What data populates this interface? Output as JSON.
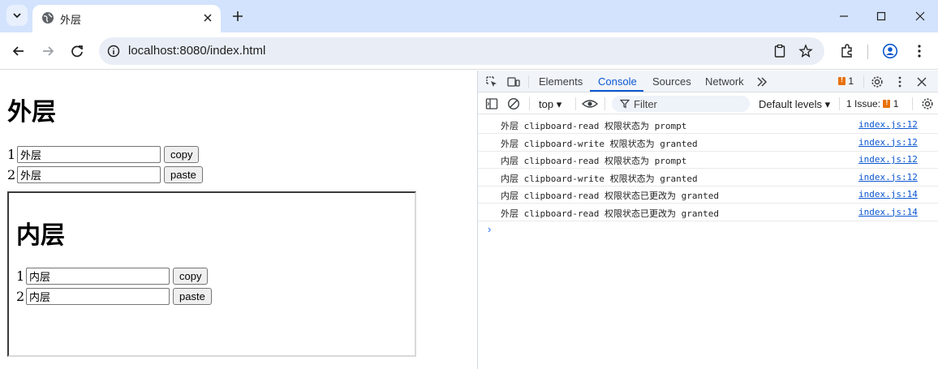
{
  "browser": {
    "tab_title": "外层",
    "url": "localhost:8080/index.html"
  },
  "page": {
    "outer": {
      "heading": "外层",
      "rows": [
        {
          "num": "1",
          "value": "外层",
          "button": "copy"
        },
        {
          "num": "2",
          "value": "外层",
          "button": "paste"
        }
      ]
    },
    "inner": {
      "heading": "内层",
      "rows": [
        {
          "num": "1",
          "value": "内层",
          "button": "copy"
        },
        {
          "num": "2",
          "value": "内层",
          "button": "paste"
        }
      ]
    }
  },
  "devtools": {
    "tabs": [
      "Elements",
      "Console",
      "Sources",
      "Network"
    ],
    "active_tab": "Console",
    "issue_count_top": "1",
    "context": "top",
    "filter_placeholder": "Filter",
    "levels": "Default levels",
    "issues_label": "1 Issue:",
    "issues_count": "1",
    "logs": [
      {
        "message": "外层 clipboard-read 权限状态为 prompt",
        "source": "index.js:12"
      },
      {
        "message": "外层 clipboard-write 权限状态为 granted",
        "source": "index.js:12"
      },
      {
        "message": "内层 clipboard-read 权限状态为 prompt",
        "source": "index.js:12"
      },
      {
        "message": "内层 clipboard-write 权限状态为 granted",
        "source": "index.js:12"
      },
      {
        "message": "内层 clipboard-read 权限状态已更改为 granted",
        "source": "index.js:14"
      },
      {
        "message": "外层 clipboard-read 权限状态已更改为 granted",
        "source": "index.js:14"
      }
    ]
  },
  "colors": {
    "titlebar": "#d3e3fd",
    "accent": "#0b57d0",
    "issue_badge": "#e8710a"
  }
}
